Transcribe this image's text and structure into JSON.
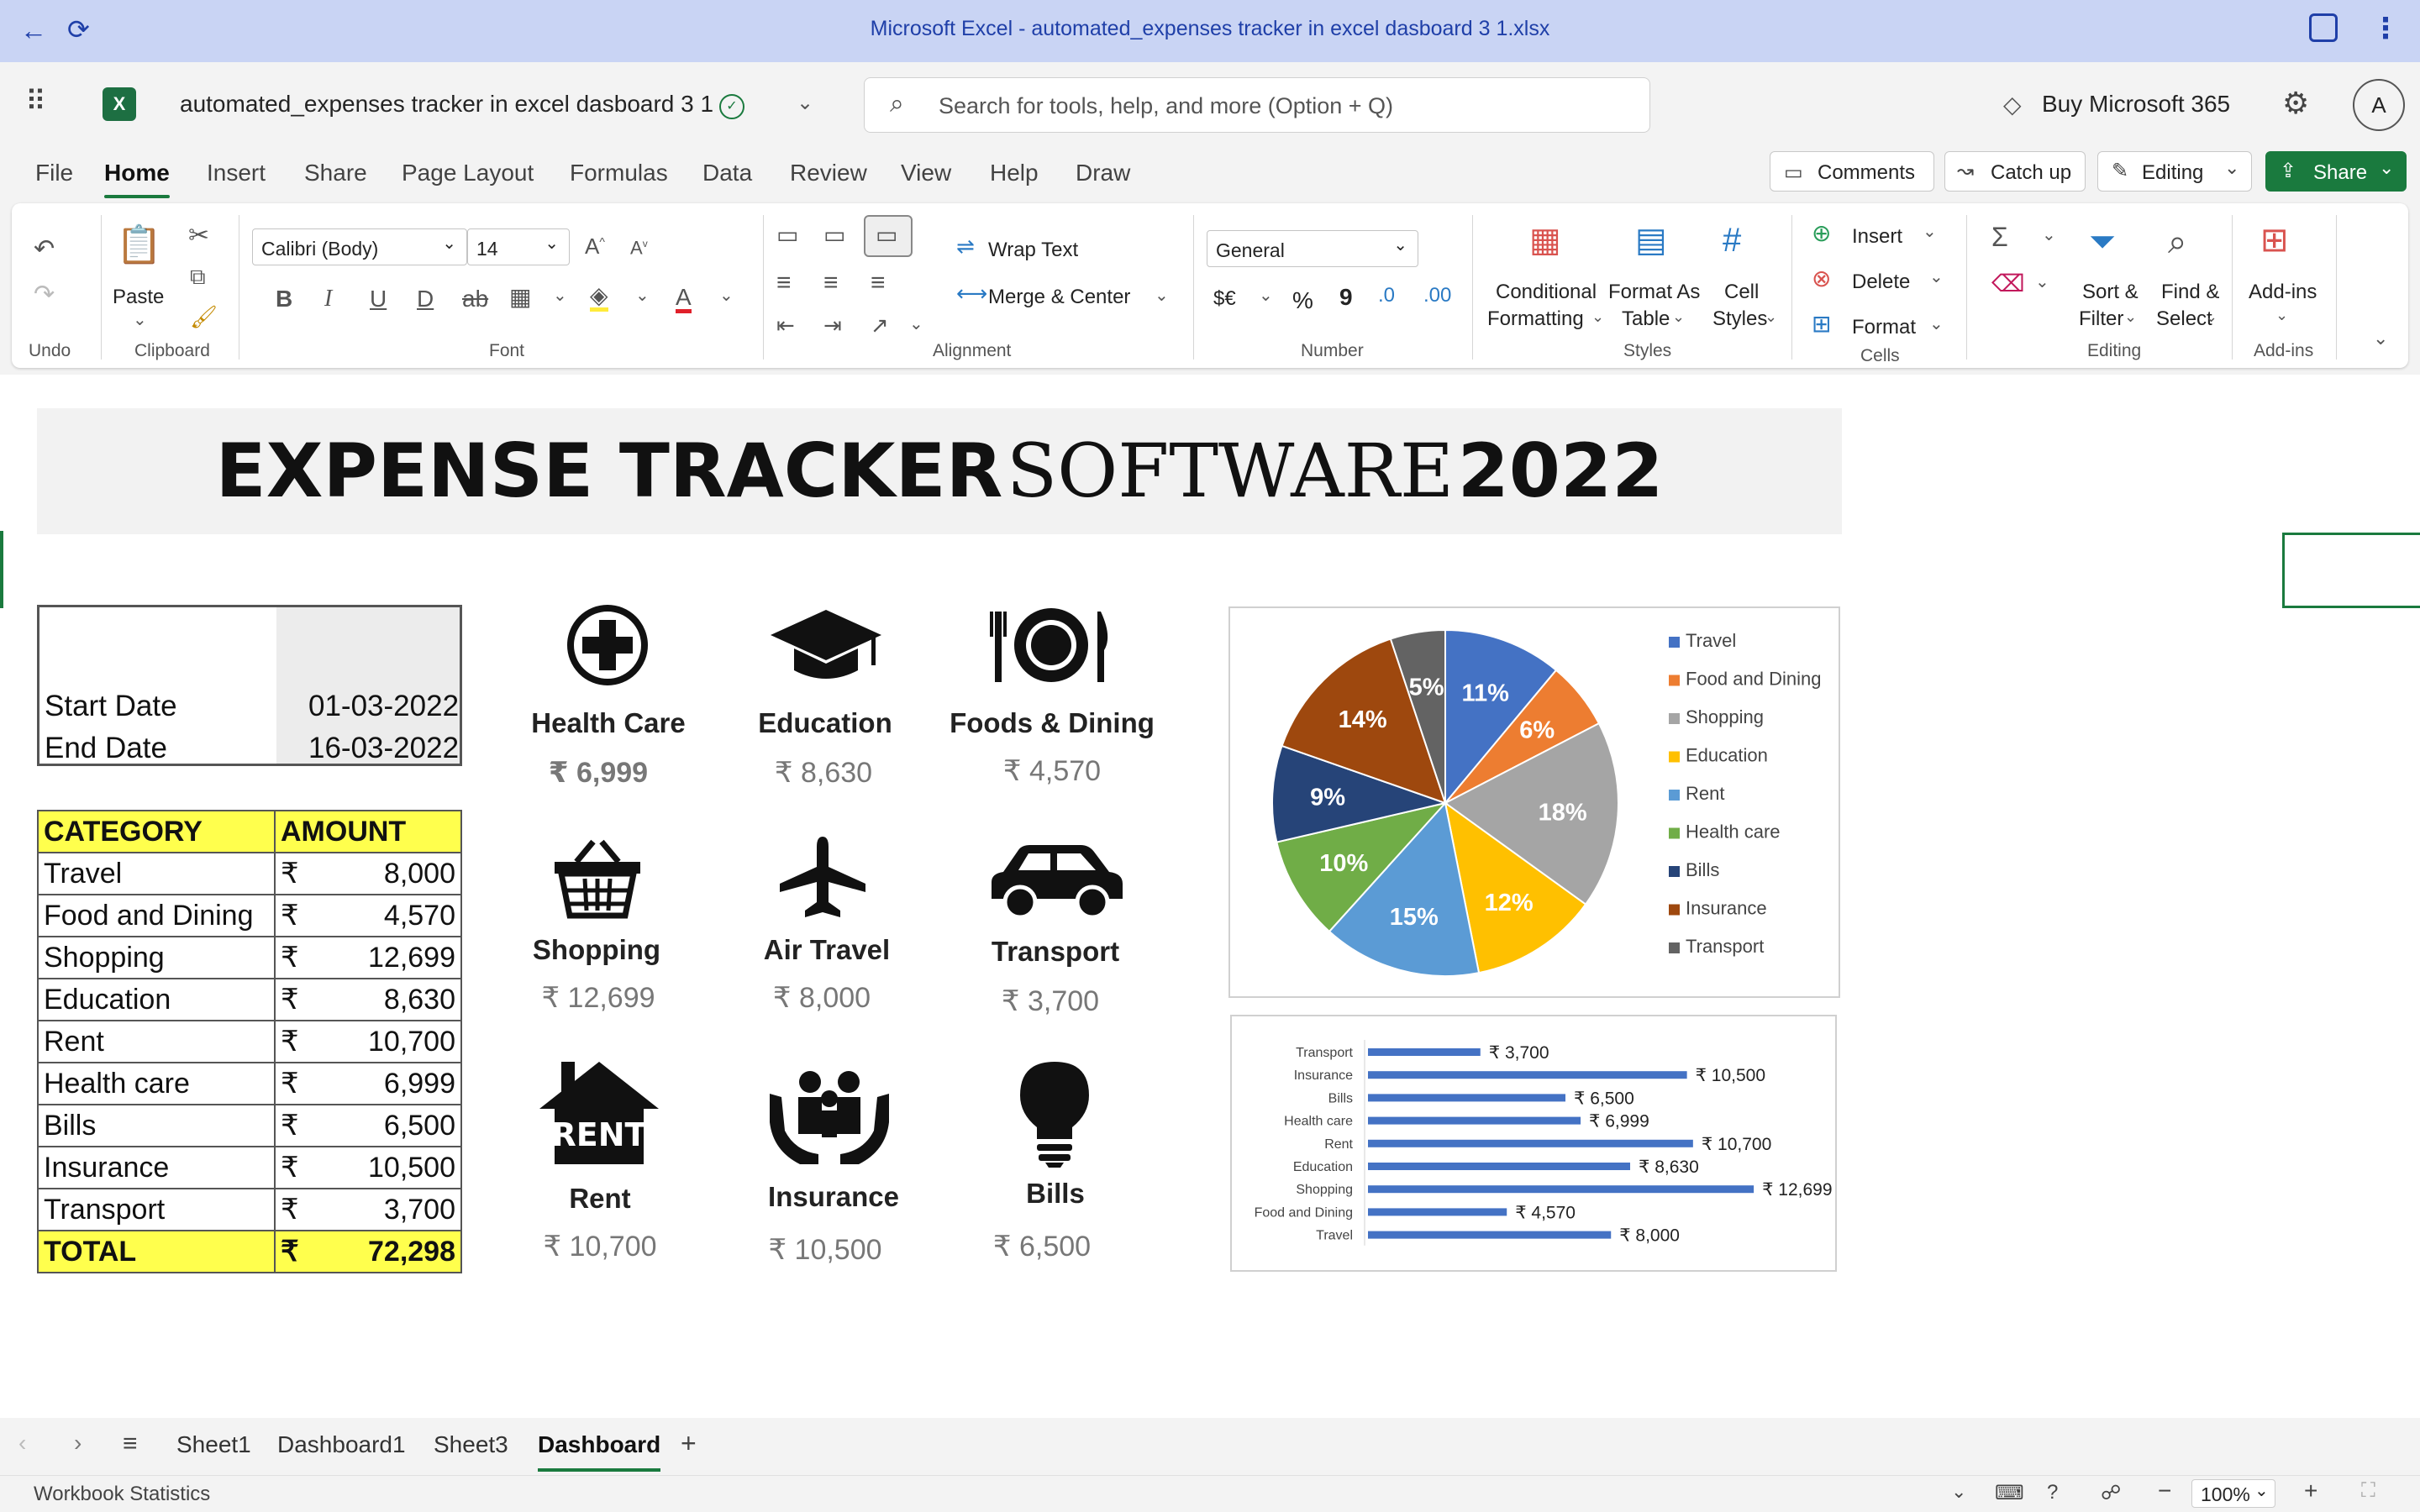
{
  "window": {
    "title": "Microsoft Excel - automated_expenses tracker in excel dasboard 3 1.xlsx"
  },
  "appbar": {
    "file_name": "automated_expenses tracker in excel dasboard 3 1",
    "search_placeholder": "Search for tools, help, and more (Option + Q)",
    "buy_label": "Buy Microsoft 365",
    "avatar_initial": "A"
  },
  "menu": {
    "items": [
      "File",
      "Home",
      "Insert",
      "Share",
      "Page Layout",
      "Formulas",
      "Data",
      "Review",
      "View",
      "Help",
      "Draw"
    ],
    "active": "Home"
  },
  "top_buttons": {
    "comments": "Comments",
    "catch_up": "Catch up",
    "editing": "Editing",
    "share": "Share"
  },
  "ribbon": {
    "undo_group": "Undo",
    "clipboard": {
      "paste": "Paste",
      "group": "Clipboard"
    },
    "font": {
      "name": "Calibri (Body)",
      "size": "14",
      "group": "Font"
    },
    "alignment": {
      "wrap": "Wrap Text",
      "merge": "Merge & Center",
      "group": "Alignment"
    },
    "number": {
      "format": "General",
      "currency": "$€",
      "percent": "%",
      "comma": "9",
      "group": "Number"
    },
    "styles": {
      "cond_1": "Conditional",
      "cond_2": "Formatting",
      "table_1": "Format As",
      "table_2": "Table",
      "cell_1": "Cell",
      "cell_2": "Styles",
      "group": "Styles"
    },
    "cells": {
      "insert": "Insert",
      "delete": "Delete",
      "format": "Format",
      "group": "Cells"
    },
    "editing": {
      "sort_1": "Sort &",
      "sort_2": "Filter",
      "find_1": "Find &",
      "find_2": "Select",
      "group": "Editing"
    },
    "addins": {
      "label": "Add-ins",
      "group": "Add-ins"
    }
  },
  "dashboard": {
    "banner": {
      "bold1": "EXPENSE TRACKER",
      "normal": "SOFTWARE",
      "bold2": "2022"
    },
    "dates": {
      "start_label": "Start Date",
      "start_value": "01-03-2022",
      "end_label": "End Date",
      "end_value": "16-03-2022"
    },
    "table": {
      "header": {
        "category": "CATEGORY",
        "amount": "AMOUNT"
      },
      "currency": "₹",
      "rows": [
        {
          "category": "Travel",
          "amount": "8,000"
        },
        {
          "category": "Food and Dining",
          "amount": "4,570"
        },
        {
          "category": "Shopping",
          "amount": "12,699"
        },
        {
          "category": "Education",
          "amount": "8,630"
        },
        {
          "category": "Rent",
          "amount": "10,700"
        },
        {
          "category": "Health care",
          "amount": "6,999"
        },
        {
          "category": "Bills",
          "amount": "6,500"
        },
        {
          "category": "Insurance",
          "amount": "10,500"
        },
        {
          "category": "Transport",
          "amount": "3,700"
        }
      ],
      "total_label": "TOTAL",
      "total_value": "72,298"
    },
    "cards": [
      {
        "icon": "health-care-icon",
        "name": "Health Care",
        "amount": "₹ 6,999"
      },
      {
        "icon": "education-icon",
        "name": "Education",
        "amount": "₹ 8,630"
      },
      {
        "icon": "dining-icon",
        "name": "Foods & Dining",
        "amount": "₹ 4,570"
      },
      {
        "icon": "shopping-icon",
        "name": "Shopping",
        "amount": "₹ 12,699"
      },
      {
        "icon": "air-travel-icon",
        "name": "Air Travel",
        "amount": "₹ 8,000"
      },
      {
        "icon": "transport-icon",
        "name": "Transport",
        "amount": "₹ 3,700"
      },
      {
        "icon": "rent-icon",
        "name": "Rent",
        "amount": "₹ 10,700"
      },
      {
        "icon": "insurance-icon",
        "name": "Insurance",
        "amount": "₹ 10,500"
      },
      {
        "icon": "bills-icon",
        "name": "Bills",
        "amount": "₹ 6,500"
      }
    ]
  },
  "chart_data": [
    {
      "type": "pie",
      "title": "",
      "categories": [
        "Travel",
        "Food and Dining",
        "Shopping",
        "Education",
        "Rent",
        "Health care",
        "Bills",
        "Insurance",
        "Transport"
      ],
      "values": [
        8000,
        4570,
        12699,
        8630,
        10700,
        6999,
        6500,
        10500,
        3700
      ],
      "labels": [
        "11%",
        "6%",
        "18%",
        "12%",
        "15%",
        "10%",
        "9%",
        "14%",
        "5%"
      ],
      "colors": [
        "#4472c4",
        "#ed7d31",
        "#a5a5a5",
        "#ffc000",
        "#5b9bd5",
        "#70ad47",
        "#264478",
        "#9e480e",
        "#636363"
      ],
      "legend": "right"
    },
    {
      "type": "bar",
      "orientation": "horizontal",
      "title": "",
      "categories": [
        "Transport",
        "Insurance",
        "Bills",
        "Health care",
        "Rent",
        "Education",
        "Shopping",
        "Food and Dining",
        "Travel"
      ],
      "values": [
        3700,
        10500,
        6500,
        6999,
        10700,
        8630,
        12699,
        4570,
        8000
      ],
      "data_labels": [
        "₹ 3,700",
        "₹ 10,500",
        "₹ 6,500",
        "₹ 6,999",
        "₹ 10,700",
        "₹ 8,630",
        "₹ 12,699",
        "₹ 4,570",
        "₹ 8,000"
      ],
      "color": "#4472c4",
      "xlim": [
        0,
        13000
      ]
    }
  ],
  "sheet_tabs": {
    "items": [
      "Sheet1",
      "Dashboard1",
      "Sheet3",
      "Dashboard"
    ],
    "active": "Dashboard"
  },
  "status": {
    "left": "Workbook Statistics",
    "zoom": "100%"
  }
}
